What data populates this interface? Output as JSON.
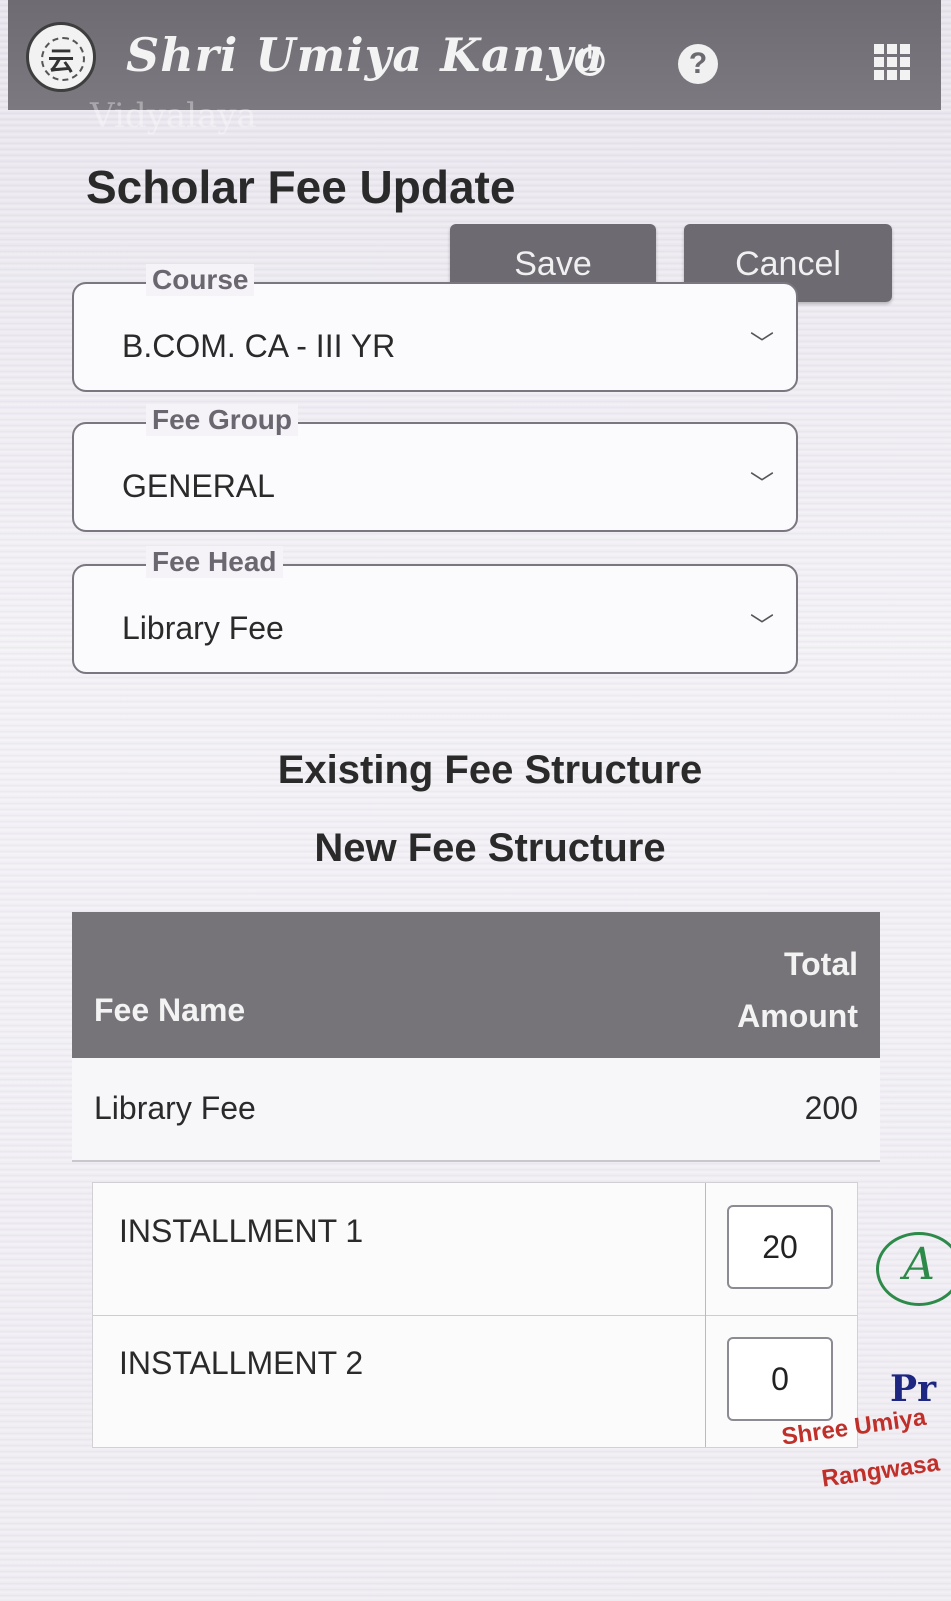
{
  "header": {
    "logo_text": "云",
    "brand": "Shri Umiya Kanya",
    "brand_sub": "Vidyalaya",
    "icons": [
      "power-icon",
      "help-icon",
      "apps-grid-icon"
    ],
    "help_glyph": "?"
  },
  "page": {
    "title": "Scholar Fee Update"
  },
  "actions": {
    "save_label": "Save",
    "cancel_label": "Cancel"
  },
  "form": {
    "course": {
      "label": "Course",
      "value": "B.COM. CA - III YR"
    },
    "fee_group": {
      "label": "Fee Group",
      "value": "GENERAL"
    },
    "fee_head": {
      "label": "Fee Head",
      "value": "Library Fee"
    }
  },
  "sections": {
    "existing": "Existing Fee Structure",
    "new": "New Fee Structure"
  },
  "fee_table": {
    "columns": {
      "name": "Fee Name",
      "amount_line1": "Total",
      "amount_line2": "Amount"
    },
    "rows": [
      {
        "name": "Library Fee",
        "amount": "200"
      }
    ]
  },
  "installments": [
    {
      "label": "INSTALLMENT 1",
      "value": "20"
    },
    {
      "label": "INSTALLMENT 2",
      "value": "0"
    }
  ],
  "stamp": {
    "signature": "A",
    "title": "Pr",
    "line1": "Shree Umiya",
    "line2": "Rangwasa"
  },
  "colors": {
    "header_bg": "#767379",
    "button_bg": "#6d6a72",
    "stamp_blue": "#1d2680",
    "stamp_red": "#c0302a",
    "signature_green": "#2e8a4a"
  }
}
